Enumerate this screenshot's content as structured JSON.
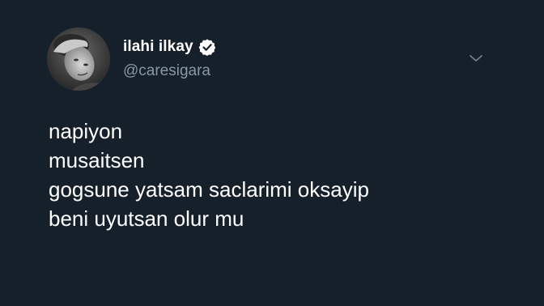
{
  "author": {
    "display_name": "ilahi ilkay",
    "handle": "@caresigara",
    "avatar_icon": "profile-photo",
    "verified_icon": "verified-badge-icon"
  },
  "tweet": {
    "lines": [
      "napiyon",
      "musaitsen",
      "gogsune yatsam saclarimi oksayip",
      "beni uyutsan olur mu"
    ]
  },
  "menu": {
    "icon": "chevron-down-icon"
  },
  "colors": {
    "background": "#15202b",
    "text_primary": "#ffffff",
    "text_secondary": "#8899a6"
  }
}
